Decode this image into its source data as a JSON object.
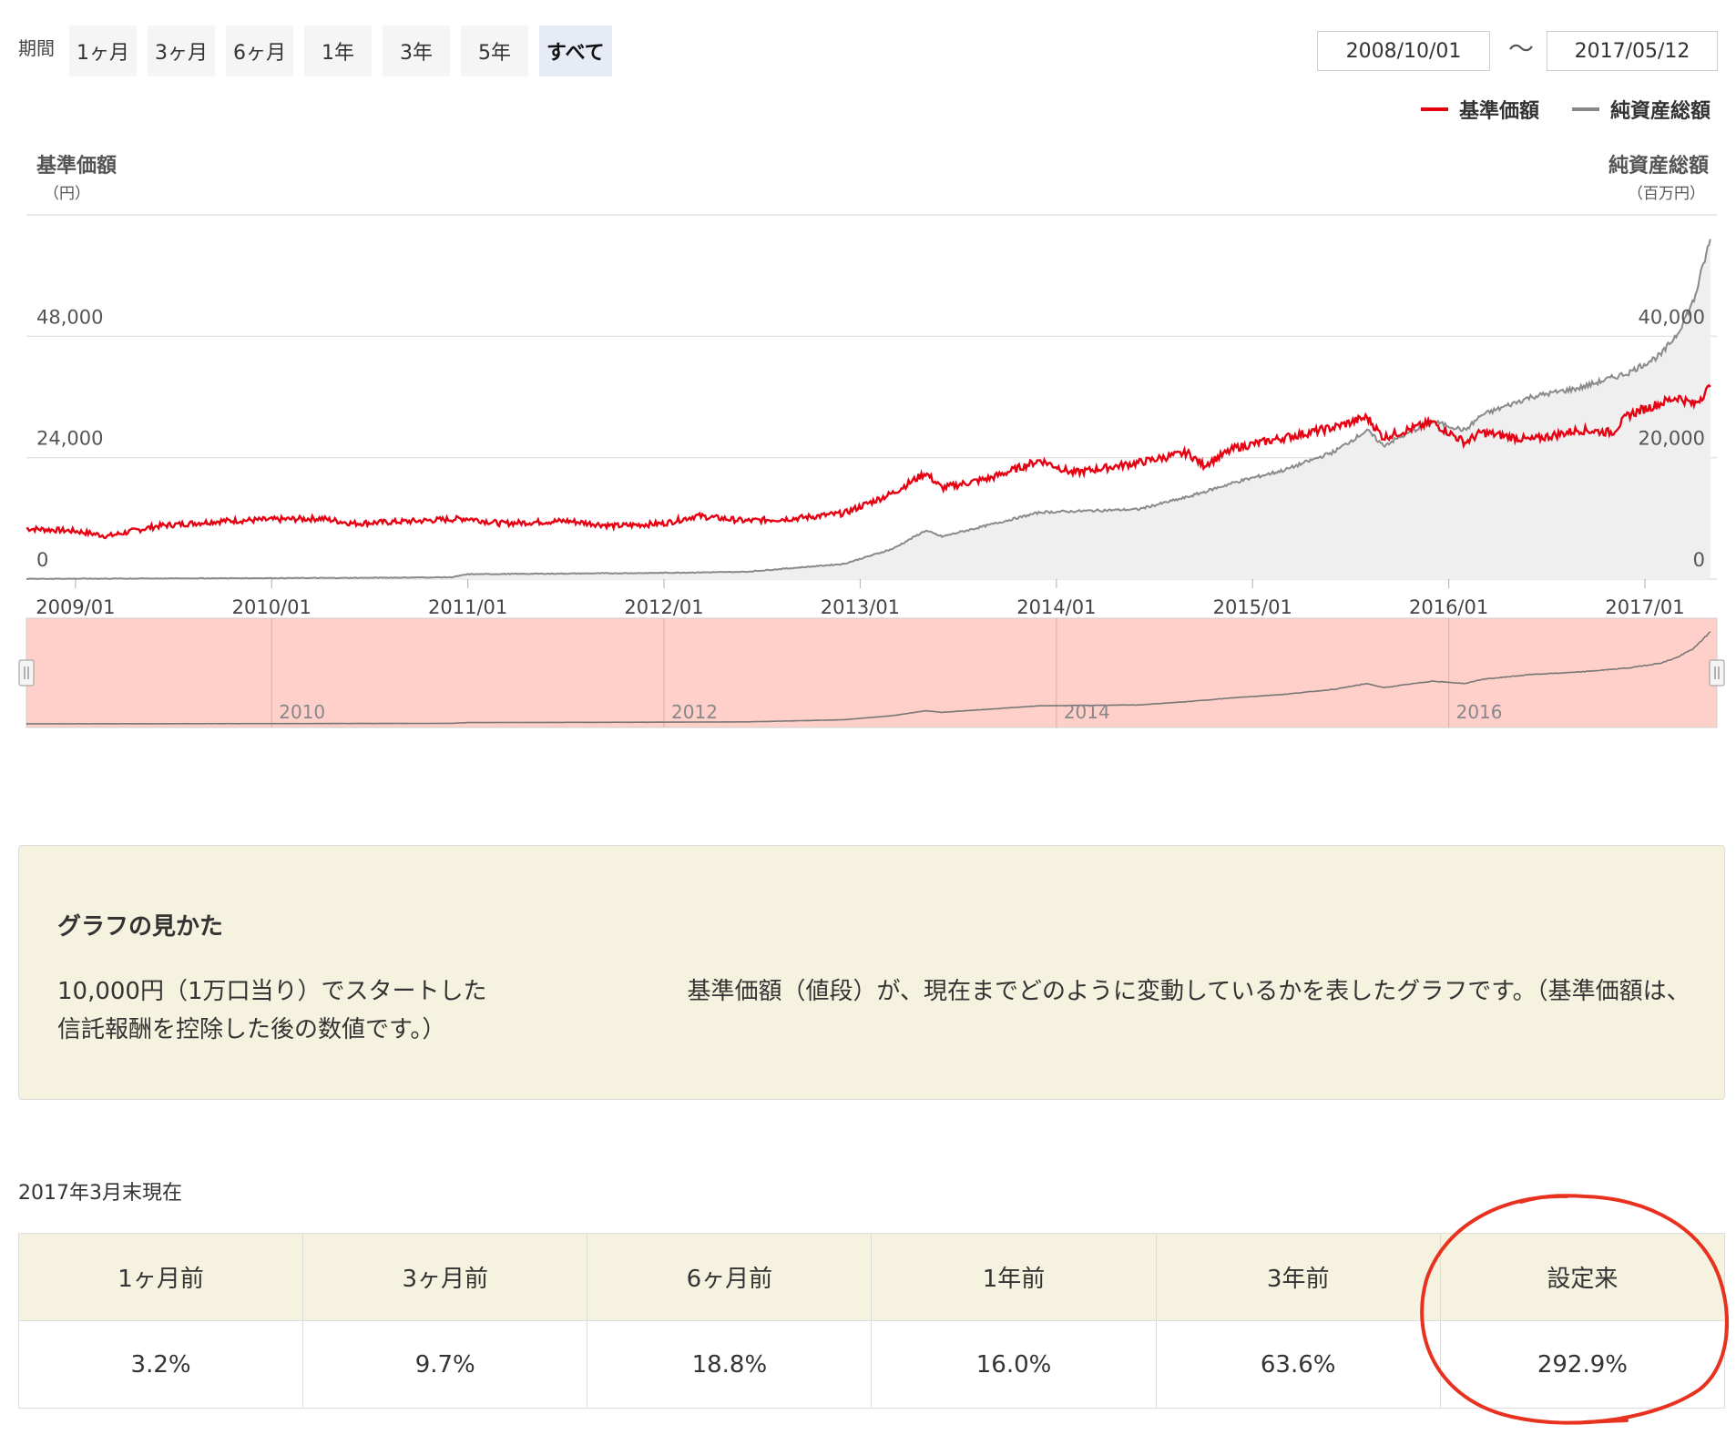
{
  "period": {
    "label": "期間",
    "buttons": [
      "1ヶ月",
      "3ヶ月",
      "6ヶ月",
      "1年",
      "3年",
      "5年",
      "すべて"
    ],
    "active_index": 6
  },
  "date_range": {
    "from": "2008/10/01",
    "separator": "〜",
    "to": "2017/05/12"
  },
  "legend": [
    {
      "label": "基準価額",
      "color": "#e60012"
    },
    {
      "label": "純資産総額",
      "color": "#888888"
    }
  ],
  "chart_data": {
    "type": "line",
    "left_axis": {
      "title": "基準価額",
      "unit": "（円）",
      "ticks": [
        "0",
        "24,000",
        "48,000"
      ],
      "ylim": [
        0,
        72000
      ]
    },
    "right_axis": {
      "title": "純資産総額",
      "unit": "（百万円）",
      "ticks": [
        "0",
        "20,000",
        "40,000"
      ],
      "ylim": [
        0,
        60000
      ]
    },
    "x_ticks": [
      "2009/01",
      "2010/01",
      "2011/01",
      "2012/01",
      "2013/01",
      "2014/01",
      "2015/01",
      "2016/01",
      "2017/01"
    ],
    "navigator_ticks": [
      "2010",
      "2012",
      "2014",
      "2016"
    ],
    "series": [
      {
        "name": "基準価額",
        "axis": "left",
        "color": "#e60012",
        "points": [
          [
            "2008/10",
            10000
          ],
          [
            "2009/01",
            9500
          ],
          [
            "2009/03",
            8500
          ],
          [
            "2009/06",
            10500
          ],
          [
            "2009/10",
            11500
          ],
          [
            "2010/04",
            12000
          ],
          [
            "2010/06",
            11000
          ],
          [
            "2010/10",
            11500
          ],
          [
            "2011/01",
            12000
          ],
          [
            "2011/03",
            11000
          ],
          [
            "2011/07",
            11500
          ],
          [
            "2011/10",
            10500
          ],
          [
            "2012/01",
            11000
          ],
          [
            "2012/03",
            12500
          ],
          [
            "2012/06",
            11500
          ],
          [
            "2012/09",
            12000
          ],
          [
            "2012/12",
            13000
          ],
          [
            "2013/03",
            17000
          ],
          [
            "2013/05",
            21000
          ],
          [
            "2013/06",
            18000
          ],
          [
            "2013/09",
            20000
          ],
          [
            "2013/12",
            23500
          ],
          [
            "2014/02",
            21000
          ],
          [
            "2014/06",
            23000
          ],
          [
            "2014/09",
            25000
          ],
          [
            "2014/10",
            22500
          ],
          [
            "2014/12",
            26000
          ],
          [
            "2015/03",
            28000
          ],
          [
            "2015/06",
            30000
          ],
          [
            "2015/08",
            32000
          ],
          [
            "2015/09",
            28000
          ],
          [
            "2015/12",
            31000
          ],
          [
            "2016/02",
            27000
          ],
          [
            "2016/03",
            29000
          ],
          [
            "2016/06",
            27500
          ],
          [
            "2016/09",
            29500
          ],
          [
            "2016/11",
            29000
          ],
          [
            "2016/12",
            32500
          ],
          [
            "2017/03",
            36000
          ],
          [
            "2017/04",
            34500
          ],
          [
            "2017/05",
            38000
          ]
        ]
      },
      {
        "name": "純資産総額",
        "axis": "right",
        "color": "#888888",
        "points": [
          [
            "2008/10",
            50
          ],
          [
            "2009/06",
            100
          ],
          [
            "2010/06",
            200
          ],
          [
            "2010/12",
            300
          ],
          [
            "2011/01",
            800
          ],
          [
            "2011/12",
            1000
          ],
          [
            "2012/06",
            1200
          ],
          [
            "2012/12",
            2500
          ],
          [
            "2013/03",
            5000
          ],
          [
            "2013/05",
            8000
          ],
          [
            "2013/06",
            7000
          ],
          [
            "2013/12",
            11000
          ],
          [
            "2014/06",
            11500
          ],
          [
            "2014/09",
            13500
          ],
          [
            "2014/12",
            16000
          ],
          [
            "2015/03",
            18000
          ],
          [
            "2015/06",
            21000
          ],
          [
            "2015/08",
            24500
          ],
          [
            "2015/09",
            22000
          ],
          [
            "2015/12",
            26000
          ],
          [
            "2016/02",
            24500
          ],
          [
            "2016/03",
            27000
          ],
          [
            "2016/06",
            30000
          ],
          [
            "2016/09",
            31500
          ],
          [
            "2016/12",
            34000
          ],
          [
            "2017/02",
            37000
          ],
          [
            "2017/03",
            40500
          ],
          [
            "2017/04",
            46000
          ],
          [
            "2017/05",
            56000
          ]
        ]
      }
    ],
    "grid": true,
    "legend_position": "top-right"
  },
  "info": {
    "title": "グラフの見かた",
    "text_part1": "10,000円（1万口当り）でスタートした",
    "text_part2": "基準価額（値段）が、現在までどのように変動しているかを表したグラフです。（基準価額は、信託報酬を控除した後の数値です。）"
  },
  "as_of": "2017年3月末現在",
  "returns": {
    "headers": [
      "1ヶ月前",
      "3ヶ月前",
      "6ヶ月前",
      "1年前",
      "3年前",
      "設定来"
    ],
    "values": [
      "3.2%",
      "9.7%",
      "18.8%",
      "16.0%",
      "63.6%",
      "292.9%"
    ]
  }
}
